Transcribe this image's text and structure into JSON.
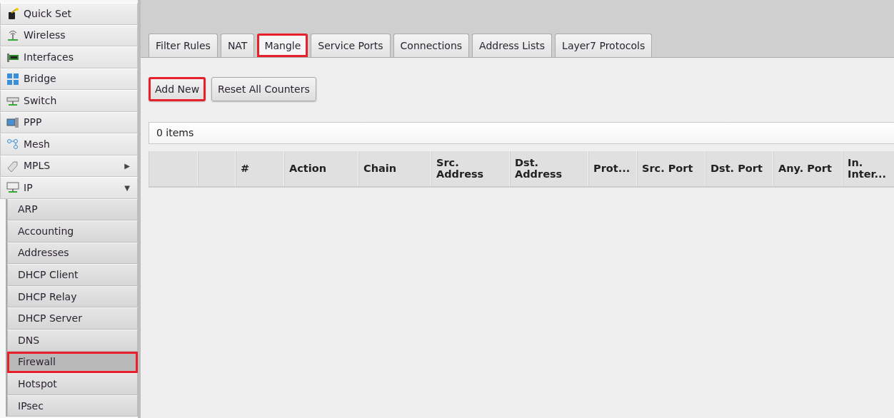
{
  "sidebar": {
    "items": [
      {
        "label": "Quick Set"
      },
      {
        "label": "Wireless"
      },
      {
        "label": "Interfaces"
      },
      {
        "label": "Bridge"
      },
      {
        "label": "Switch"
      },
      {
        "label": "PPP"
      },
      {
        "label": "Mesh"
      },
      {
        "label": "MPLS",
        "arrow": "▶"
      },
      {
        "label": "IP",
        "arrow": "▼",
        "children": [
          {
            "label": "ARP",
            "selected": false,
            "highlighted": false
          },
          {
            "label": "Accounting",
            "selected": false,
            "highlighted": false
          },
          {
            "label": "Addresses",
            "selected": false,
            "highlighted": false
          },
          {
            "label": "DHCP Client",
            "selected": false,
            "highlighted": false
          },
          {
            "label": "DHCP Relay",
            "selected": false,
            "highlighted": false
          },
          {
            "label": "DHCP Server",
            "selected": false,
            "highlighted": false
          },
          {
            "label": "DNS",
            "selected": false,
            "highlighted": false
          },
          {
            "label": "Firewall",
            "selected": true,
            "highlighted": true
          },
          {
            "label": "Hotspot",
            "selected": false,
            "highlighted": false
          },
          {
            "label": "IPsec",
            "selected": false,
            "highlighted": false
          }
        ]
      }
    ]
  },
  "tabs": [
    {
      "label": "Filter Rules",
      "selected": false,
      "highlighted": false
    },
    {
      "label": "NAT",
      "selected": false,
      "highlighted": false
    },
    {
      "label": "Mangle",
      "selected": true,
      "highlighted": true
    },
    {
      "label": "Service Ports",
      "selected": false,
      "highlighted": false
    },
    {
      "label": "Connections",
      "selected": false,
      "highlighted": false
    },
    {
      "label": "Address Lists",
      "selected": false,
      "highlighted": false
    },
    {
      "label": "Layer7 Protocols",
      "selected": false,
      "highlighted": false
    }
  ],
  "buttons": [
    {
      "label": "Add New",
      "highlighted": true
    },
    {
      "label": "Reset All Counters",
      "highlighted": false
    }
  ],
  "table": {
    "item_count": "0 items",
    "columns": [
      "#",
      "Action",
      "Chain",
      "Src. Address",
      "Dst. Address",
      "Prot...",
      "Src. Port",
      "Dst. Port",
      "Any. Port",
      "In. Inter..."
    ]
  }
}
